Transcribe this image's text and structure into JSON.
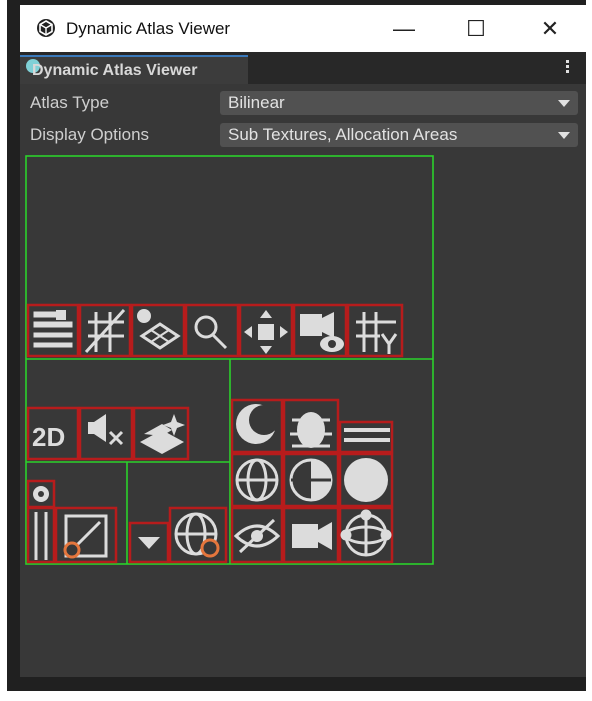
{
  "window": {
    "title": "Dynamic Atlas Viewer",
    "minimize_glyph": "—",
    "maximize_glyph": "☐",
    "close_glyph": "✕"
  },
  "tab": {
    "label": "Dynamic Atlas Viewer"
  },
  "fields": {
    "atlas_type": {
      "label": "Atlas Type",
      "value": "Bilinear"
    },
    "display_options": {
      "label": "Display Options",
      "value": "Sub Textures, Allocation Areas"
    }
  },
  "atlas": {
    "allocation_color": "#2bd12b",
    "subtexture_color": "#b71c1c",
    "icon_color": "#dcdcdc",
    "accent_color": "#e4763d",
    "text_2d": "2D",
    "icons": [
      "settings-sliders-icon",
      "shading-pattern-icon",
      "layers-grid-icon",
      "search-icon",
      "move-tool-icon",
      "camera-visibility-icon",
      "grid-snap-icon",
      "2d-toggle-icon",
      "audio-mute-icon",
      "lighting-effects-icon",
      "moon-icon",
      "bug-icon",
      "lines-icon",
      "globe-icon",
      "globe-shaded-icon",
      "sphere-icon",
      "eye-hidden-icon",
      "video-camera-icon",
      "orbit-icon",
      "slider-knob-icon",
      "scale-tool-icon",
      "dropdown-arrow-icon",
      "globe-settings-icon"
    ]
  }
}
